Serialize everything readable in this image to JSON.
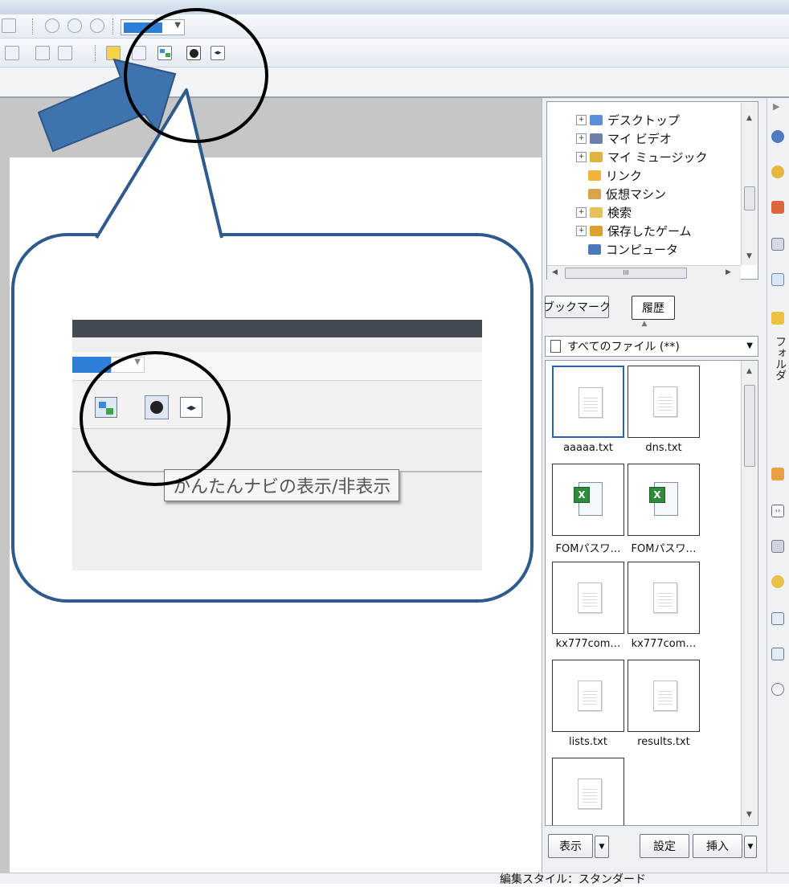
{
  "tree": {
    "items": [
      {
        "label": "デスクトップ",
        "expander": "+",
        "color": "#5a8fd8"
      },
      {
        "label": "マイ ビデオ",
        "expander": "+",
        "color": "#6b7fa8"
      },
      {
        "label": "マイ ミュージック",
        "expander": "+",
        "color": "#e0b33a"
      },
      {
        "label": "リンク",
        "expander": "",
        "color": "#f0b33a"
      },
      {
        "label": "仮想マシン",
        "expander": "",
        "color": "#d8a54a"
      },
      {
        "label": "検索",
        "expander": "+",
        "color": "#e8c05a"
      },
      {
        "label": "保存したゲーム",
        "expander": "+",
        "color": "#e0a030"
      },
      {
        "label": "コンピュータ",
        "expander": "",
        "color": "#4a78b8"
      }
    ],
    "hscroll_thumb": "III"
  },
  "tabs": {
    "bookmark": "ブックマーク",
    "history": "履歴"
  },
  "filter": {
    "value": "すべてのファイル (**)"
  },
  "files": [
    {
      "name": "aaaaa.txt",
      "type": "txt",
      "selected": true
    },
    {
      "name": "dns.txt",
      "type": "txt"
    },
    {
      "name": "FOMパスワ…",
      "type": "xls"
    },
    {
      "name": "FOMパスワ…",
      "type": "xls"
    },
    {
      "name": "kx777com…",
      "type": "txt"
    },
    {
      "name": "kx777com…",
      "type": "txt"
    },
    {
      "name": "lists.txt",
      "type": "txt"
    },
    {
      "name": "results.txt",
      "type": "txt"
    },
    {
      "name": "",
      "type": "txt"
    }
  ],
  "panel_buttons": {
    "view": "表示",
    "settings": "設定",
    "insert": "挿入"
  },
  "rail": {
    "folder_label": "フォルダ"
  },
  "callout": {
    "tooltip": "かんたんナビの表示/非表示"
  },
  "status": {
    "text": "編集スタイル：スタンダード"
  },
  "colors": {
    "accent": "#2f7fd9",
    "arrow": "#3f73ad",
    "callout_border": "#2e5a8c"
  }
}
